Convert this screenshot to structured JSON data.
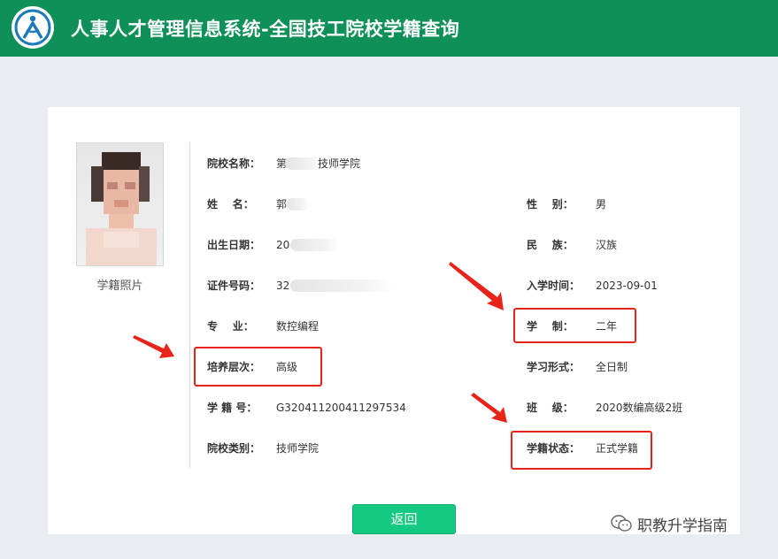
{
  "header": {
    "title": "人事人才管理信息系统-全国技工院校学籍查询"
  },
  "photo": {
    "caption": "学籍照片"
  },
  "fields": {
    "school_name": {
      "label": "院校名称：",
      "value": "第",
      "value_tail": "技师学院"
    },
    "name": {
      "label": "姓    名：",
      "value": "郭"
    },
    "gender": {
      "label": "性    别：",
      "value": "男"
    },
    "birth_date": {
      "label": "出生日期：",
      "value": "20"
    },
    "ethnicity": {
      "label": "民    族：",
      "value": "汉族"
    },
    "id_number": {
      "label": "证件号码：",
      "value": "32"
    },
    "enroll_date": {
      "label": "入学时间：",
      "value": "2023-09-01"
    },
    "major": {
      "label": "专    业：",
      "value": "数控编程"
    },
    "duration": {
      "label": "学    制：",
      "value": "二年"
    },
    "level": {
      "label": "培养层次：",
      "value": "高级"
    },
    "study_mode": {
      "label": "学习形式：",
      "value": "全日制"
    },
    "student_no": {
      "label": "学 籍 号：",
      "value": "G320411200411297534"
    },
    "class": {
      "label": "班    级：",
      "value": "2020数编高级2班"
    },
    "school_type": {
      "label": "院校类别：",
      "value": "技师学院"
    },
    "status": {
      "label": "学籍状态：",
      "value": "正式学籍"
    }
  },
  "buttons": {
    "back": "返回"
  },
  "watermark": {
    "text": "职教升学指南"
  },
  "colors": {
    "header": "#0f9059",
    "button": "#14c981",
    "highlight": "#e8241a",
    "background": "#e9edf1"
  }
}
